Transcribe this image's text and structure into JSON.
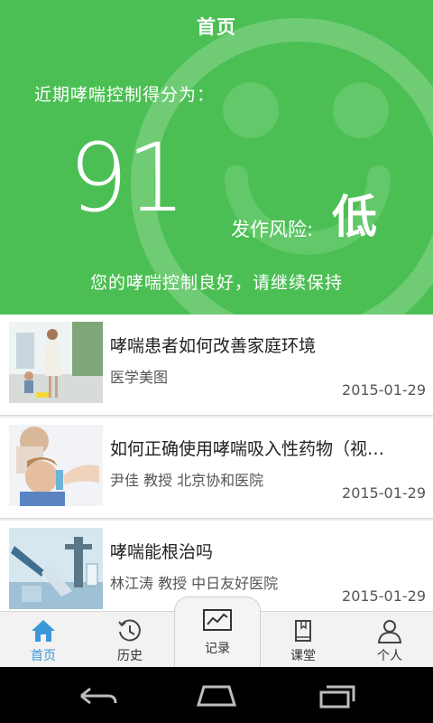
{
  "header": {
    "title": "首页"
  },
  "score_panel": {
    "label": "近期哮喘控制得分为：",
    "score": "91",
    "risk_label": "发作风险:",
    "risk_value": "低",
    "hint": "您的哮喘控制良好，请继续保持"
  },
  "articles": [
    {
      "title": "哮喘患者如何改善家庭环境",
      "author": "医学美图",
      "date": "2015-01-29"
    },
    {
      "title": "如何正确使用哮喘吸入性药物（视…",
      "author": "尹佳 教授 北京协和医院",
      "date": "2015-01-29"
    },
    {
      "title": "哮喘能根治吗",
      "author": "林江涛 教授 中日友好医院",
      "date": "2015-01-29"
    }
  ],
  "tabs": [
    {
      "label": "首页",
      "icon": "home-icon"
    },
    {
      "label": "历史",
      "icon": "history-icon"
    },
    {
      "label": "记录",
      "icon": "chart-line-icon"
    },
    {
      "label": "课堂",
      "icon": "book-icon"
    },
    {
      "label": "个人",
      "icon": "person-icon"
    }
  ],
  "colors": {
    "brand_green": "#4cbf54",
    "active_tab": "#3a98d9"
  }
}
